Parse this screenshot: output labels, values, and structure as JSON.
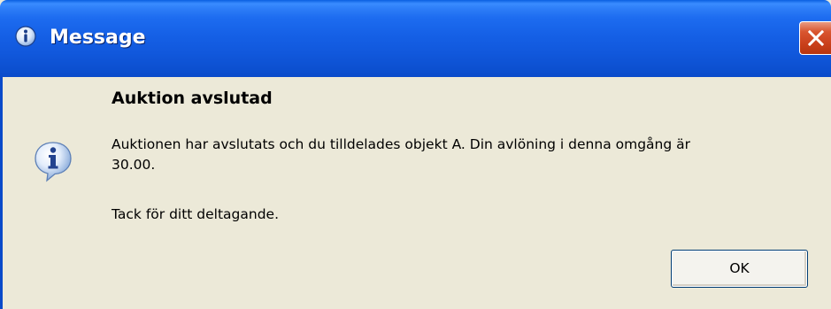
{
  "window": {
    "title": "Message"
  },
  "dialog": {
    "heading": "Auktion avslutad",
    "body_lines": [
      "Auktionen har avslutats och du tilldelades objekt A. Din avlöning i denna omgång är",
      "30.00."
    ],
    "thanks": "Tack för ditt deltagande.",
    "ok_label": "OK",
    "icon": "information-icon"
  },
  "colors": {
    "titlebar": "#1D6CF0",
    "dialog_bg": "#ECE9D8",
    "close_button": "#D9552F",
    "button_border": "#003C74"
  }
}
